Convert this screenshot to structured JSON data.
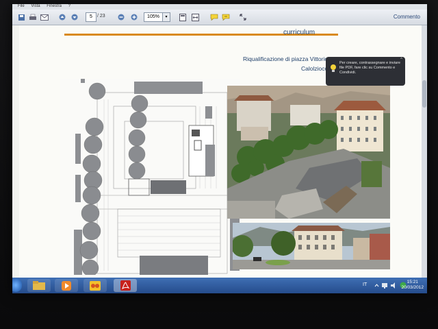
{
  "window": {
    "menu": [
      "File",
      "Vista",
      "Finestra",
      "?"
    ],
    "page_current": "5",
    "page_total": "/ 23",
    "zoom": "105%",
    "zoom_dropdown": "▾",
    "comment_link": "Commento"
  },
  "document": {
    "section_label": "curriculum",
    "title_line1": "Riqualificazione di piazza Vittorio Veneto",
    "title_line2": "Calolziocorte (Lecco)"
  },
  "tooltip": {
    "close": "^",
    "text": "Per creare, contrassegnare e inviare file PDF, fare clic su Commento e Condividi."
  },
  "taskbar": {
    "lang": "IT",
    "time": "15:21",
    "date": "20/03/2012"
  },
  "colors": {
    "accent_line": "#d98a1a",
    "title_text": "#1f3f6a",
    "taskbar": "#2f5c9e"
  }
}
